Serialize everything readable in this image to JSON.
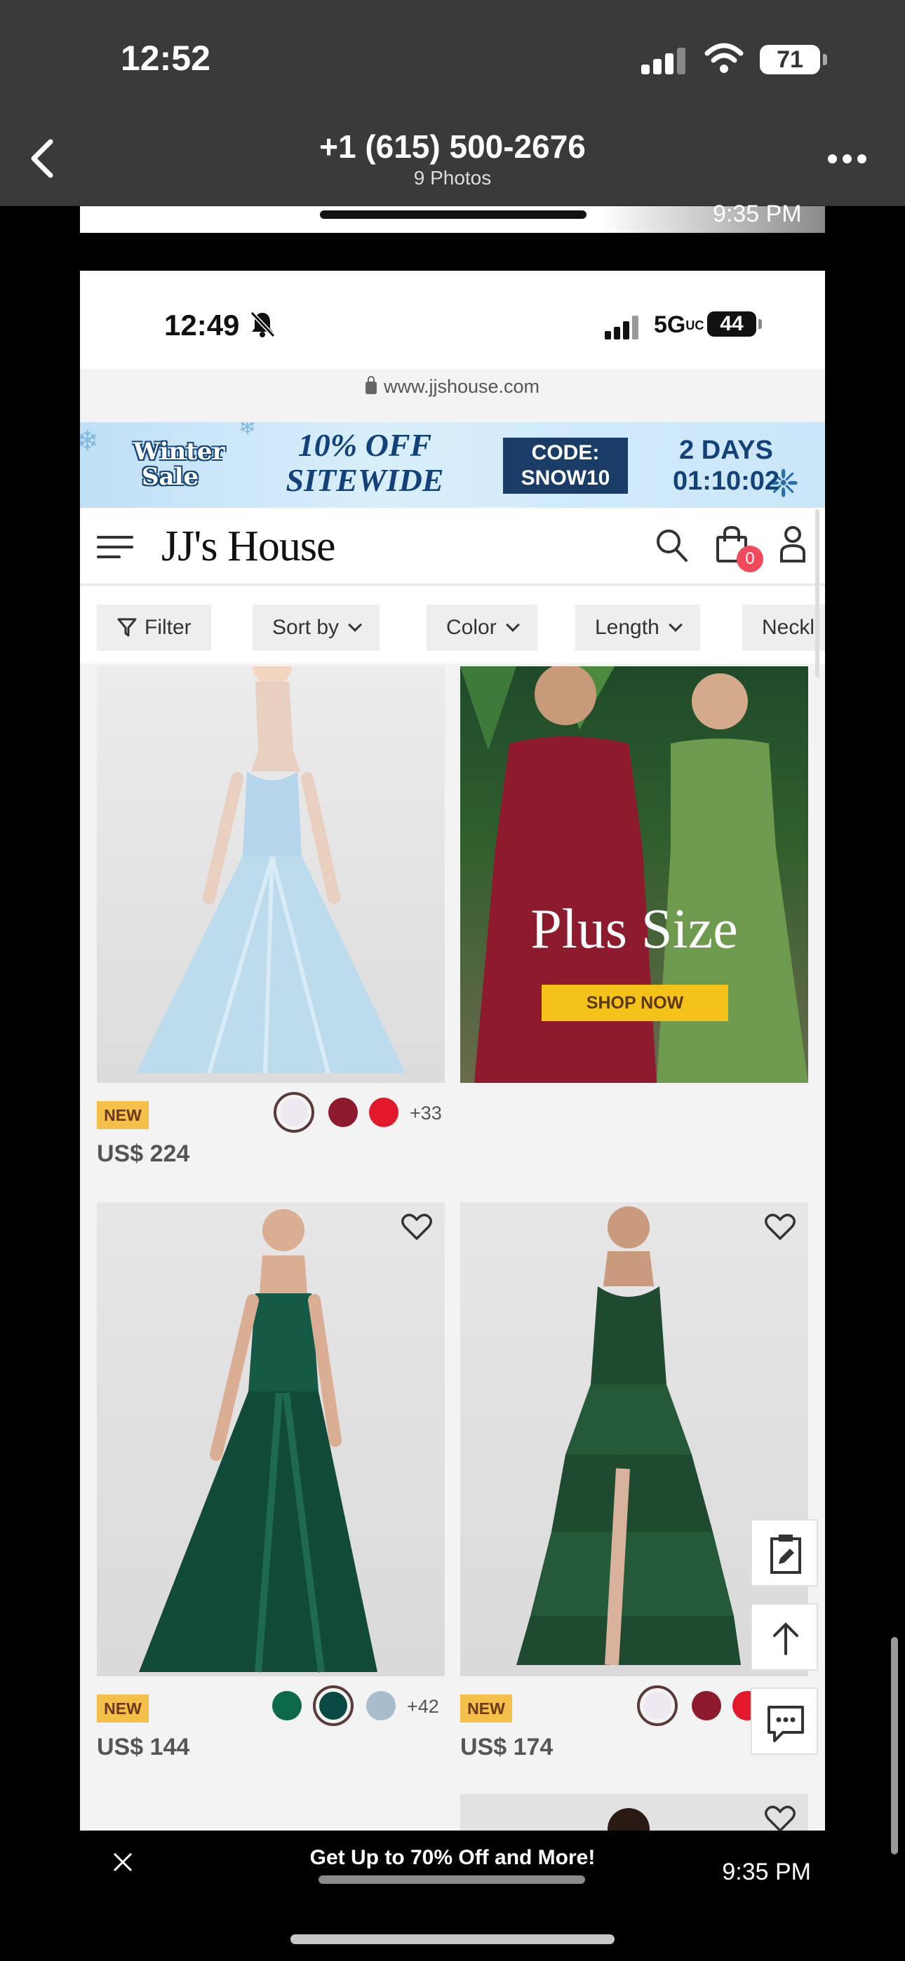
{
  "outer_status": {
    "time": "12:52",
    "battery": "71"
  },
  "outer_nav": {
    "title": "+1 (615) 500-2676",
    "subtitle": "9 Photos"
  },
  "prev_photo": {
    "time": "9:35 PM"
  },
  "inner_status": {
    "time": "12:49",
    "network": "5G",
    "network_suffix": "UC",
    "battery": "44"
  },
  "browser": {
    "url": "www.jjshouse.com"
  },
  "promo_banner": {
    "sale_line1": "Winter",
    "sale_line2": "Sale",
    "offer_line1": "10% OFF",
    "offer_line2": "SITEWIDE",
    "code_line1": "CODE:",
    "code_line2": "SNOW10",
    "countdown_line1": "2 DAYS",
    "countdown_line2": "01:10:02"
  },
  "site_header": {
    "logo": "JJ's House",
    "cart_count": "0"
  },
  "filters": [
    {
      "label": "Filter"
    },
    {
      "label": "Sort by"
    },
    {
      "label": "Color"
    },
    {
      "label": "Length"
    },
    {
      "label": "Neckli"
    }
  ],
  "products": [
    {
      "badge": "NEW",
      "price": "US$ 224",
      "swatches": [
        "#f0e8f0",
        "#8e1a2e",
        "#e3182a"
      ],
      "more_colors": "+33",
      "dress_color": "#bcdcee"
    },
    {
      "badge": "NEW",
      "price": "US$ 144",
      "swatches": [
        "#0c6a4a",
        "#0b4a42",
        "#a8bcd0"
      ],
      "more_colors": "+42",
      "dress_color": "#124a3a"
    },
    {
      "badge": "NEW",
      "price": "US$ 174",
      "swatches": [
        "#f0e8f0",
        "#8e1a2e",
        "#e3182a"
      ],
      "more_colors": "",
      "dress_color": "#1e4a30"
    }
  ],
  "promo_tile": {
    "headline": "Plus Size",
    "cta": "SHOP NOW"
  },
  "bottom_bar": {
    "promo": "Get Up to 70% Off and More!",
    "time": "9:35 PM"
  },
  "colors": {
    "accent_badge": "#f4c04a",
    "cart_badge": "#f24a5a",
    "banner_navy": "#13427a",
    "cta_yellow": "#f5c21a"
  }
}
